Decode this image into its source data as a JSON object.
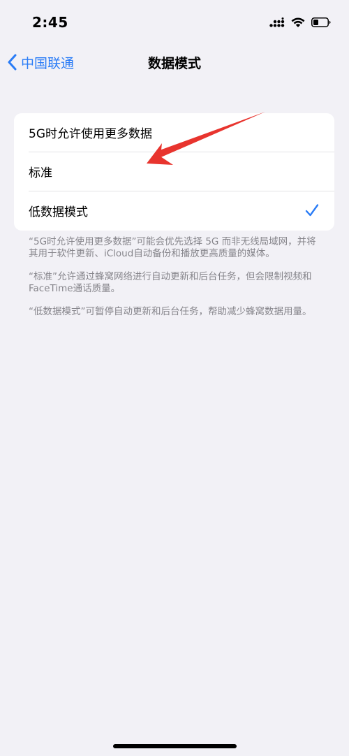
{
  "status_bar": {
    "time": "2:45",
    "icons": [
      "cellular-signal-icon",
      "wifi-icon",
      "battery-icon"
    ]
  },
  "nav": {
    "back_label": "中国联通",
    "title": "数据模式"
  },
  "options": [
    {
      "label": "5G时允许使用更多数据",
      "selected": false
    },
    {
      "label": "标准",
      "selected": false
    },
    {
      "label": "低数据模式",
      "selected": true
    }
  ],
  "notes": [
    "“5G时允许使用更多数据”可能会优先选择 5G 而非无线局域网，并将其用于软件更新、iCloud自动备份和播放更高质量的媒体。",
    "“标准”允许通过蜂窝网络进行自动更新和后台任务，但会限制视频和FaceTime通话质量。",
    "“低数据模式”可暂停自动更新和后台任务，帮助减少蜂窝数据用量。"
  ],
  "colors": {
    "accent": "#2a7cf6",
    "background": "#f2f1f6",
    "annotation": "#e8342e"
  }
}
